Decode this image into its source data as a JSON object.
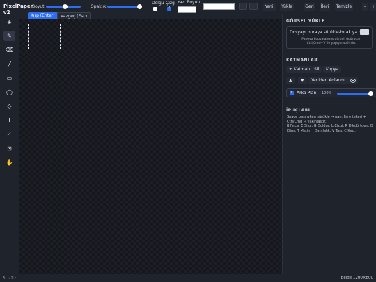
{
  "app": {
    "name_line1": "PixelPaper",
    "name_line2": "v2"
  },
  "toolbar": {
    "size_label": "Boyut",
    "size_value": 0.55,
    "opacity_label": "Opaklık",
    "opacity_value": 1.0,
    "fill_label": "Dolgu",
    "fill_checked": false,
    "stroke_label": "Çizgi",
    "stroke_checked": true,
    "font_size_label": "Yazı Boyutu",
    "font_size_value": "",
    "text_value": "",
    "new_label": "Yeni",
    "load_label": "Yükle",
    "undo_label": "Geri",
    "redo_label": "İleri",
    "clear_label": "Temizle",
    "zoom_out_label": "-",
    "zoom_in_label": "+"
  },
  "subtoolbar": {
    "crop_label": "Kırp (Enter)",
    "cancel_label": "Vazgeç (Esc)"
  },
  "tools": [
    {
      "name": "select-tool",
      "glyph": "◈",
      "active": false
    },
    {
      "name": "pencil-tool",
      "glyph": "✎",
      "active": true
    },
    {
      "name": "eraser-tool",
      "glyph": "⌫",
      "active": false
    },
    {
      "name": "line-tool",
      "glyph": "╱",
      "active": false
    },
    {
      "name": "rectangle-tool",
      "glyph": "▭",
      "active": false
    },
    {
      "name": "ellipse-tool",
      "glyph": "◯",
      "active": false
    },
    {
      "name": "fill-tool",
      "glyph": "◇",
      "active": false
    },
    {
      "name": "text-tool",
      "glyph": "I",
      "active": false
    },
    {
      "name": "eyedropper-tool",
      "glyph": "⟋",
      "active": false
    },
    {
      "name": "crop-tool",
      "glyph": "⊡",
      "active": false
    },
    {
      "name": "hand-tool",
      "glyph": "✋",
      "active": false
    }
  ],
  "image_upload": {
    "title": "GÖRSEL YÜKLE",
    "drop_text": "Dosyayı buraya sürükle-bırak ya da",
    "drop_hint": "Panoya kopyalanmış görseli doğrudan Ctrl/Cmd+V ile yapıştırabilirsin."
  },
  "layers": {
    "title": "KATMANLAR",
    "add_label": "+ Katman",
    "delete_label": "Sil",
    "copy_label": "Kopya",
    "up_label": "▲",
    "down_label": "▼",
    "rename_label": "Yeniden Adlandır",
    "visibility_icon": "eye-icon",
    "items": [
      {
        "name": "Arka Plan",
        "visible": true,
        "opacity_label": "100%",
        "opacity_value": 1.0
      }
    ]
  },
  "tips": {
    "title": "İPUÇLARI",
    "text": "Space basılıyken sürükle → pan. Fare tekeri + Ctrl/Cmd → yakınlaştır.\nB Fırça, E Silgi, G Doldur, L Çizgi, R Dikdörtgen, O Elips, T Metin, I Damlalık, V Taşı, C Kırp."
  },
  "status": {
    "cursor": "X: -, Y: -",
    "doc": "Belge 1200×800"
  }
}
